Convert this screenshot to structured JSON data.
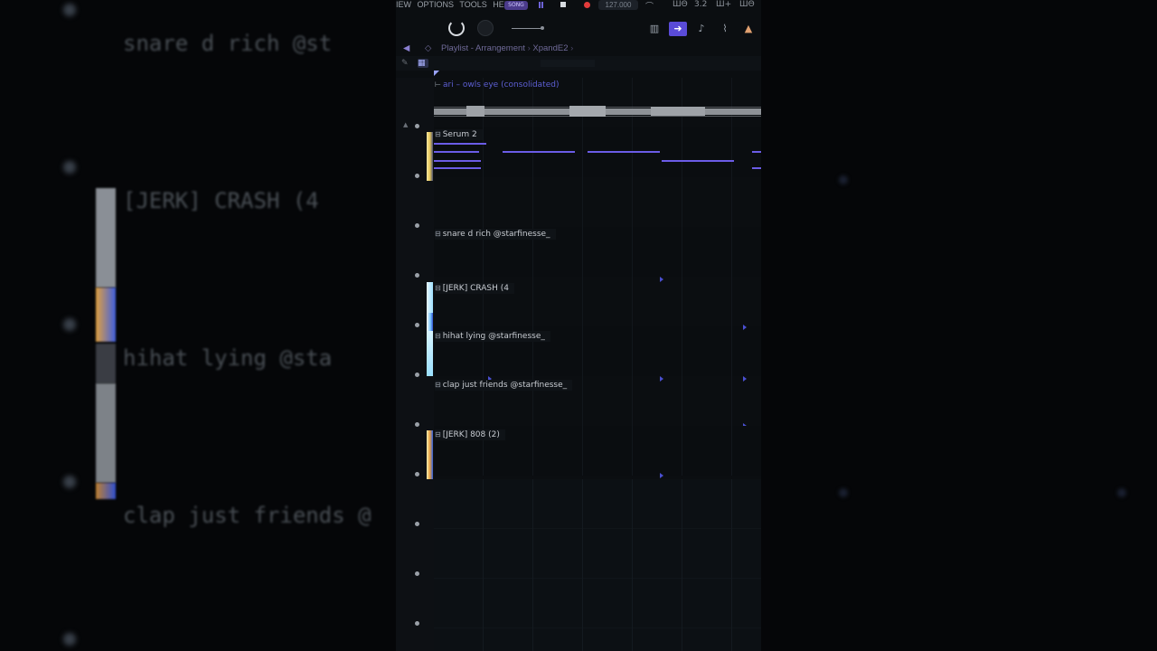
{
  "menu": {
    "items": [
      "IEW",
      "OPTIONS",
      "TOOLS",
      "HELP"
    ]
  },
  "transport": {
    "pattern_label": "SONG",
    "tempo": "127.000"
  },
  "toolbar": {
    "indicators": [
      "3.2",
      "Ш+",
      "ШΘ"
    ]
  },
  "breadcrumb": {
    "title": "Playlist - Arrangement",
    "separator": "›",
    "pattern": "XpandE2",
    "trailing": "›"
  },
  "tracks": [
    {
      "label": "ari – owls eye (consolidated)",
      "type": "audio"
    },
    {
      "label": "Serum 2",
      "type": "midi"
    },
    {
      "label": "",
      "type": "empty"
    },
    {
      "label": "snare d rich @starfinesse_",
      "type": "audio"
    },
    {
      "label": "[JERK] CRASH (4",
      "type": "audio"
    },
    {
      "label": "hihat lying @starfinesse_",
      "type": "audio"
    },
    {
      "label": "clap just friends @starfinesse_",
      "type": "audio"
    },
    {
      "label": "[JERK] 808 (2)",
      "type": "audio"
    }
  ],
  "background": {
    "labels": [
      "snare d rich @st",
      "[JERK] CRASH (4",
      "hihat lying @sta",
      "clap just friends @"
    ]
  },
  "colors": {
    "accent": "#5a4bd8",
    "midi_note": "#6b5ce6",
    "audio_label": "#5d5fd4",
    "record": "#e23b3b"
  },
  "icons": {
    "back": "triangle-left-icon",
    "piano_roll": "piano-icon",
    "playlist": "arrow-right-icon",
    "mixer": "mixer-icon",
    "link": "link-icon",
    "plugin": "hat-icon"
  }
}
